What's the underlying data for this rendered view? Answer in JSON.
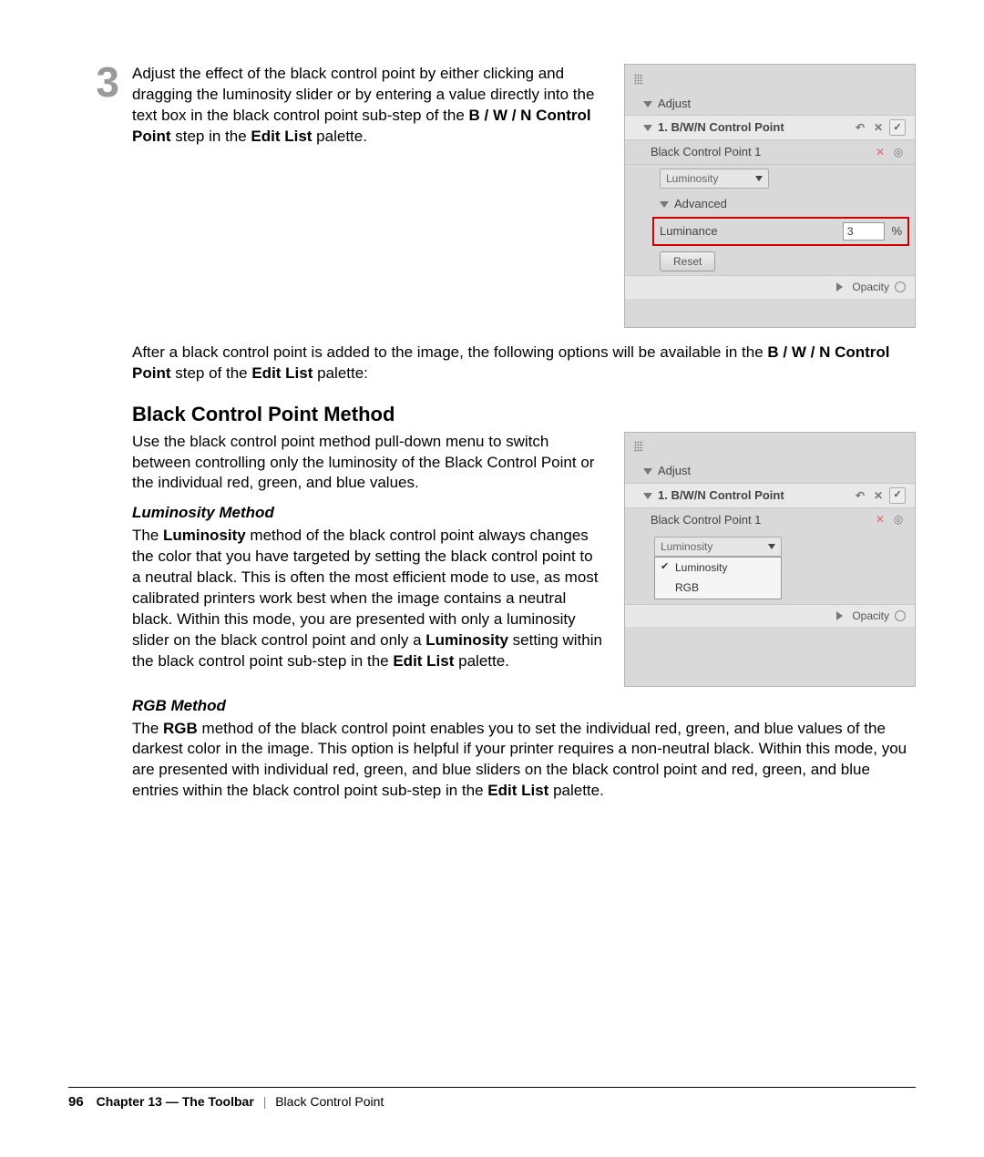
{
  "step": {
    "number": "3",
    "text_a": "Adjust the effect of the black control point by either clicking and dragging the luminosity slider or by entering a value directly into the text box in the black control point sub-step of the ",
    "bold_a": "B / W / N Control Point",
    "text_b": " step in the ",
    "bold_b": "Edit List",
    "text_c": " palette."
  },
  "panel1": {
    "adjust": "Adjust",
    "step_title": "1. B/W/N Control Point",
    "substep": "Black Control Point 1",
    "dropdown": "Luminosity",
    "advanced": "Advanced",
    "luminance_label": "Luminance",
    "luminance_value": "3",
    "luminance_unit": "%",
    "reset": "Reset",
    "opacity": "Opacity"
  },
  "intro2_a": "After a black control point is added to the image, the following options will be available in the ",
  "intro2_bold1": "B / W / N Control Point",
  "intro2_b": " step of the ",
  "intro2_bold2": "Edit List",
  "intro2_c": " palette:",
  "heading": "Black Control Point Method",
  "method_intro": "Use the black control point method pull-down menu to switch between controlling only the luminosity of the Black Control Point or the individual red, green, and blue values.",
  "lum_heading": "Luminosity Method",
  "lum_a": "The ",
  "lum_bold1": "Luminosity",
  "lum_b": " method of the black control point always changes the color that you have targeted by setting the black control point to a neutral black. This is often the most efficient mode to use, as most calibrated printers work best when the image contains a neutral black. Within this mode, you are presented with only a luminosity slider on the black control point and only a ",
  "lum_bold2": "Luminosity",
  "lum_c": " setting within the black control point sub-step in the ",
  "lum_bold3": "Edit List",
  "lum_d": " palette.",
  "panel2": {
    "adjust": "Adjust",
    "step_title": "1. B/W/N Control Point",
    "substep": "Black Control Point 1",
    "dropdown": "Luminosity",
    "opt1": "Luminosity",
    "opt2": "RGB",
    "opacity": "Opacity"
  },
  "rgb_heading": "RGB Method",
  "rgb_a": "The ",
  "rgb_bold1": "RGB",
  "rgb_b": " method of the black control point enables you to set the individual red, green, and blue values of the darkest color in the image. This option is helpful if your printer requires a non-neutral black. Within this mode, you are presented with individual red, green, and blue sliders on the black control point and red, green, and blue entries within the black control point sub-step in the ",
  "rgb_bold2": "Edit List",
  "rgb_c": " palette.",
  "footer": {
    "page": "96",
    "chapter": "Chapter 13 — The Toolbar",
    "section": "Black Control Point"
  }
}
